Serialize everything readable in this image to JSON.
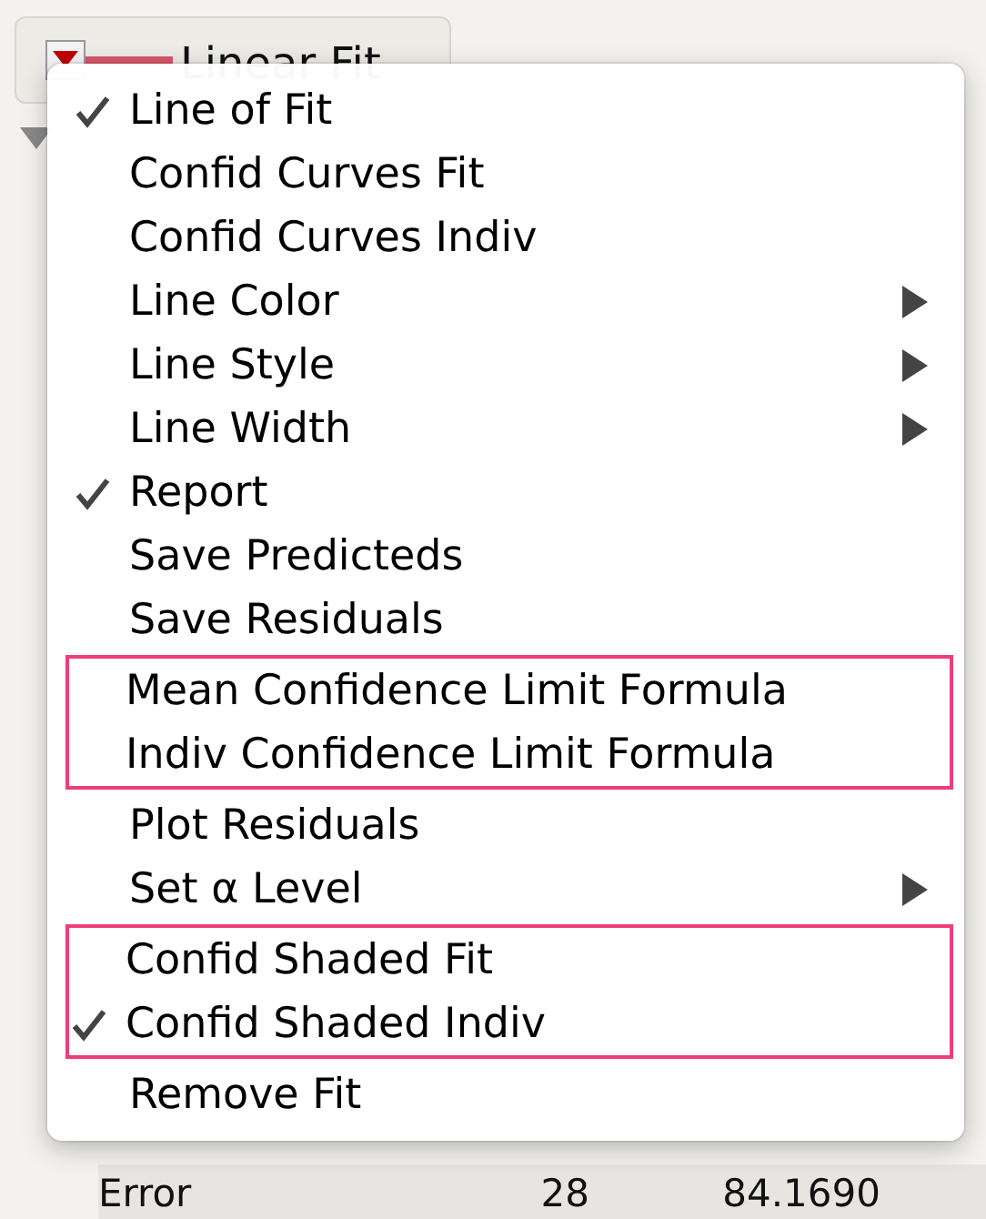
{
  "header": {
    "title": "Linear Fit"
  },
  "table_row": {
    "cells": [
      "Error",
      "28",
      "84.1690"
    ]
  },
  "menu": {
    "groups": [
      {
        "outlined": false,
        "items": [
          {
            "label": "Line of Fit",
            "checked": true,
            "submenu": false
          },
          {
            "label": "Confid Curves Fit",
            "checked": false,
            "submenu": false
          },
          {
            "label": "Confid Curves Indiv",
            "checked": false,
            "submenu": false
          },
          {
            "label": "Line Color",
            "checked": false,
            "submenu": true
          },
          {
            "label": "Line Style",
            "checked": false,
            "submenu": true
          },
          {
            "label": "Line Width",
            "checked": false,
            "submenu": true
          },
          {
            "label": "Report",
            "checked": true,
            "submenu": false
          },
          {
            "label": "Save Predicteds",
            "checked": false,
            "submenu": false
          },
          {
            "label": "Save Residuals",
            "checked": false,
            "submenu": false
          }
        ]
      },
      {
        "outlined": true,
        "items": [
          {
            "label": "Mean Confidence Limit Formula",
            "checked": false,
            "submenu": false
          },
          {
            "label": "Indiv Confidence Limit Formula",
            "checked": false,
            "submenu": false
          }
        ]
      },
      {
        "outlined": false,
        "items": [
          {
            "label": "Plot Residuals",
            "checked": false,
            "submenu": false
          },
          {
            "label": "Set α Level",
            "checked": false,
            "submenu": true
          }
        ]
      },
      {
        "outlined": true,
        "items": [
          {
            "label": "Confid Shaded Fit",
            "checked": false,
            "submenu": false
          },
          {
            "label": "Confid Shaded Indiv",
            "checked": true,
            "submenu": false
          }
        ]
      },
      {
        "outlined": false,
        "items": [
          {
            "label": "Remove Fit",
            "checked": false,
            "submenu": false
          }
        ]
      }
    ]
  }
}
